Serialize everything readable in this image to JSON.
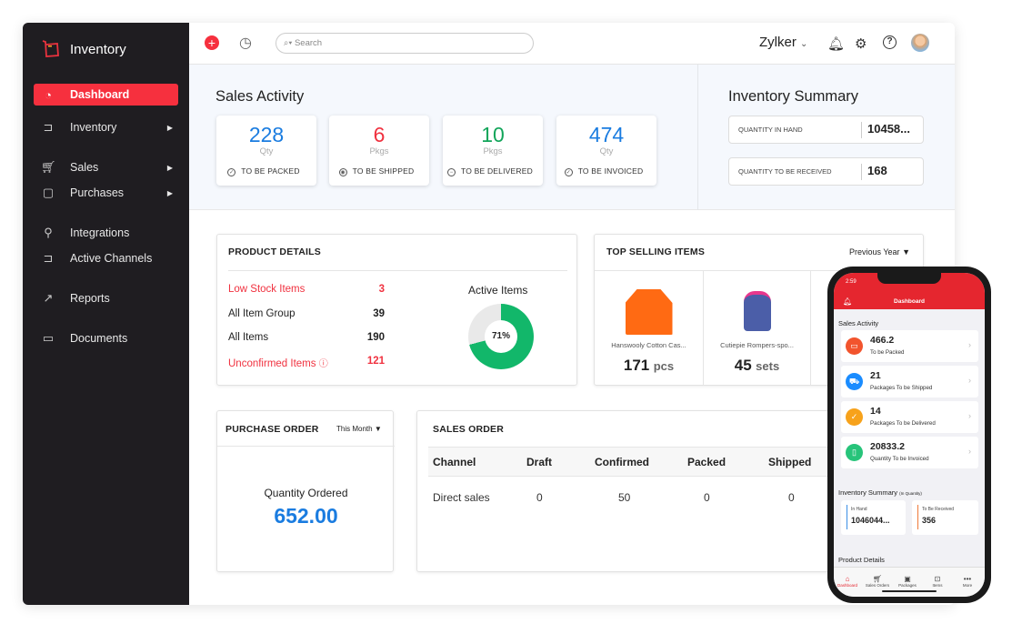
{
  "app": {
    "name": "Inventory",
    "brand_color": "#f6303e",
    "sidebar_color": "#1f1d21"
  },
  "sidebar": {
    "items": [
      {
        "label": "Dashboard",
        "icon": "dashboard-gauge-icon",
        "active": true
      },
      {
        "label": "Inventory",
        "icon": "cart-dolly-icon",
        "submenu": true
      },
      {
        "label": "Sales",
        "icon": "shopping-cart-icon",
        "submenu": true
      },
      {
        "label": "Purchases",
        "icon": "shopping-bag-icon",
        "submenu": true
      },
      {
        "label": "Integrations",
        "icon": "plug-icon"
      },
      {
        "label": "Active Channels",
        "icon": "channels-icon"
      },
      {
        "label": "Reports",
        "icon": "chart-line-icon"
      },
      {
        "label": "Documents",
        "icon": "folder-icon"
      }
    ]
  },
  "header": {
    "search_placeholder": "Search",
    "org": "Zylker"
  },
  "sales_activity": {
    "title": "Sales Activity",
    "cards": [
      {
        "value": "228",
        "unit": "Qty",
        "label": "TO BE PACKED",
        "color": "#1a7ce0"
      },
      {
        "value": "6",
        "unit": "Pkgs",
        "label": "TO BE SHIPPED",
        "color": "#f0313f"
      },
      {
        "value": "10",
        "unit": "Pkgs",
        "label": "TO BE DELIVERED",
        "color": "#12a55a"
      },
      {
        "value": "474",
        "unit": "Qty",
        "label": "TO BE INVOICED",
        "color": "#1a7ce0"
      }
    ]
  },
  "inventory_summary": {
    "title": "Inventory Summary",
    "rows": [
      {
        "label": "QUANTITY IN HAND",
        "value": "10458..."
      },
      {
        "label": "QUANTITY TO BE RECEIVED",
        "value": "168"
      }
    ]
  },
  "product_details": {
    "title": "PRODUCT DETAILS",
    "rows": [
      {
        "label": "Low Stock Items",
        "value": "3",
        "alert": true
      },
      {
        "label": "All Item Group",
        "value": "39"
      },
      {
        "label": "All Items",
        "value": "190"
      },
      {
        "label": "Unconfirmed Items",
        "value": "121",
        "alert": true
      }
    ],
    "active_items_label": "Active Items",
    "active_items_percent": 71,
    "active_items_text": "71%"
  },
  "top_selling": {
    "title": "TOP SELLING ITEMS",
    "period": "Previous Year",
    "items": [
      {
        "name": "Hanswooly Cotton Cas...",
        "qty": "171",
        "unit": "pcs"
      },
      {
        "name": "Cutiepie Rompers-spo...",
        "qty": "45",
        "unit": "sets"
      }
    ]
  },
  "purchase_order": {
    "title": "PURCHASE ORDER",
    "period": "This Month",
    "label": "Quantity Ordered",
    "value": "652.00"
  },
  "sales_order": {
    "title": "SALES ORDER",
    "columns": [
      "Channel",
      "Draft",
      "Confirmed",
      "Packed",
      "Shipped"
    ],
    "rows": [
      [
        "Direct sales",
        "0",
        "50",
        "0",
        "0"
      ]
    ]
  },
  "mobile": {
    "time": "2:59",
    "title": "Dashboard",
    "sales_activity": "Sales Activity",
    "cards": [
      {
        "value": "466.2",
        "label": "To be Packed",
        "color": "#f2542d"
      },
      {
        "value": "21",
        "label": "Packages To be Shipped",
        "color": "#1a8cff"
      },
      {
        "value": "14",
        "label": "Packages To be Delivered",
        "color": "#f7a21b"
      },
      {
        "value": "20833.2",
        "label": "Quantity To be Invoiced",
        "color": "#27c47a"
      }
    ],
    "inventory_summary": "Inventory Summary",
    "inventory_summary_note": "(In Quantity)",
    "in_hand_label": "In Hand",
    "in_hand": "1046044...",
    "to_receive_label": "To Be Received",
    "to_receive": "356",
    "product_details": "Product Details",
    "tabs": [
      "Dashboard",
      "Sales Orders",
      "Packages",
      "Items",
      "More"
    ]
  }
}
